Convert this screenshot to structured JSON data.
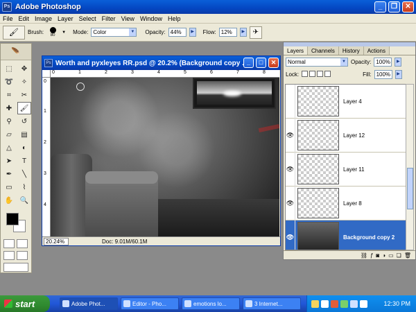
{
  "app": {
    "title": "Adobe Photoshop"
  },
  "menu": [
    "File",
    "Edit",
    "Image",
    "Layer",
    "Select",
    "Filter",
    "View",
    "Window",
    "Help"
  ],
  "options": {
    "brush_label": "Brush:",
    "brush_size": "80",
    "mode_label": "Mode:",
    "mode_value": "Color",
    "opacity_label": "Opacity:",
    "opacity_value": "44%",
    "flow_label": "Flow:",
    "flow_value": "12%"
  },
  "document": {
    "title": "Worth and pyxleyes RR.psd @ 20.2% (Background copy ...",
    "zoom": "20.24%",
    "doc_info": "Doc: 9.01M/60.1M",
    "ruler_top": [
      "0",
      "1",
      "2",
      "3",
      "4",
      "5",
      "6",
      "7",
      "8"
    ],
    "ruler_left": [
      "0",
      "1",
      "2",
      "3",
      "4"
    ]
  },
  "layers_palette": {
    "tabs": [
      "Layers",
      "Channels",
      "History",
      "Actions"
    ],
    "active_tab": "Layers",
    "blend_mode": "Normal",
    "opacity_label": "Opacity:",
    "opacity_value": "100%",
    "lock_label": "Lock:",
    "fill_label": "Fill:",
    "fill_value": "100%",
    "layers": [
      {
        "name": "Layer 4",
        "visible": false,
        "selected": false
      },
      {
        "name": "Layer 12",
        "visible": true,
        "selected": false
      },
      {
        "name": "Layer 11",
        "visible": true,
        "selected": false
      },
      {
        "name": "Layer 8",
        "visible": true,
        "selected": false
      },
      {
        "name": "Background copy 2",
        "visible": true,
        "selected": true
      }
    ]
  },
  "taskbar": {
    "start_label": "start",
    "tasks": [
      "Adobe Phot...",
      "Editor - Pho...",
      "emotions lo...",
      "3 Internet..."
    ],
    "clock": "12:30 PM"
  },
  "colors": {
    "titlebar": "#0447c2",
    "selection": "#316ac5",
    "start_green": "#2f8a2f"
  }
}
